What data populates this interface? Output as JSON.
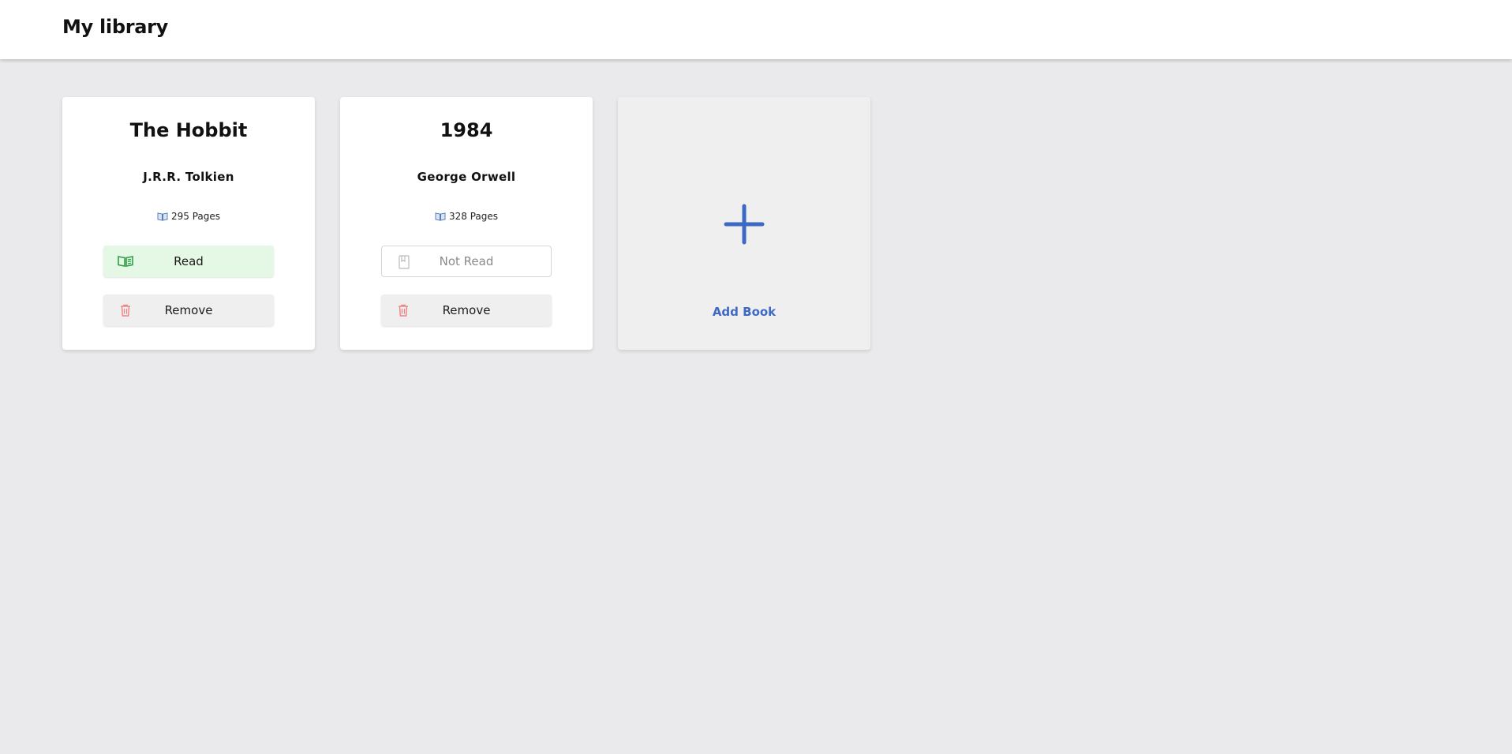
{
  "header": {
    "title": "My library"
  },
  "books": [
    {
      "title": "The Hobbit",
      "author": "J.R.R. Tolkien",
      "pages_text": "295 Pages",
      "status_label": "Read",
      "remove_label": "Remove"
    },
    {
      "title": "1984",
      "author": "George Orwell",
      "pages_text": "328 Pages",
      "status_label": "Not Read",
      "remove_label": "Remove"
    }
  ],
  "add_card": {
    "label": "Add Book"
  },
  "icons": {
    "pages": "open-book-icon",
    "read": "open-book-icon",
    "not_read": "bookmark-icon",
    "remove": "trash-icon",
    "add": "plus-icon"
  },
  "colors": {
    "read_bg": "#e5f7e5",
    "read_icon": "#2e9e46",
    "remove_icon": "#f08080",
    "accent": "#3d69c4",
    "background": "#eaeaec"
  }
}
